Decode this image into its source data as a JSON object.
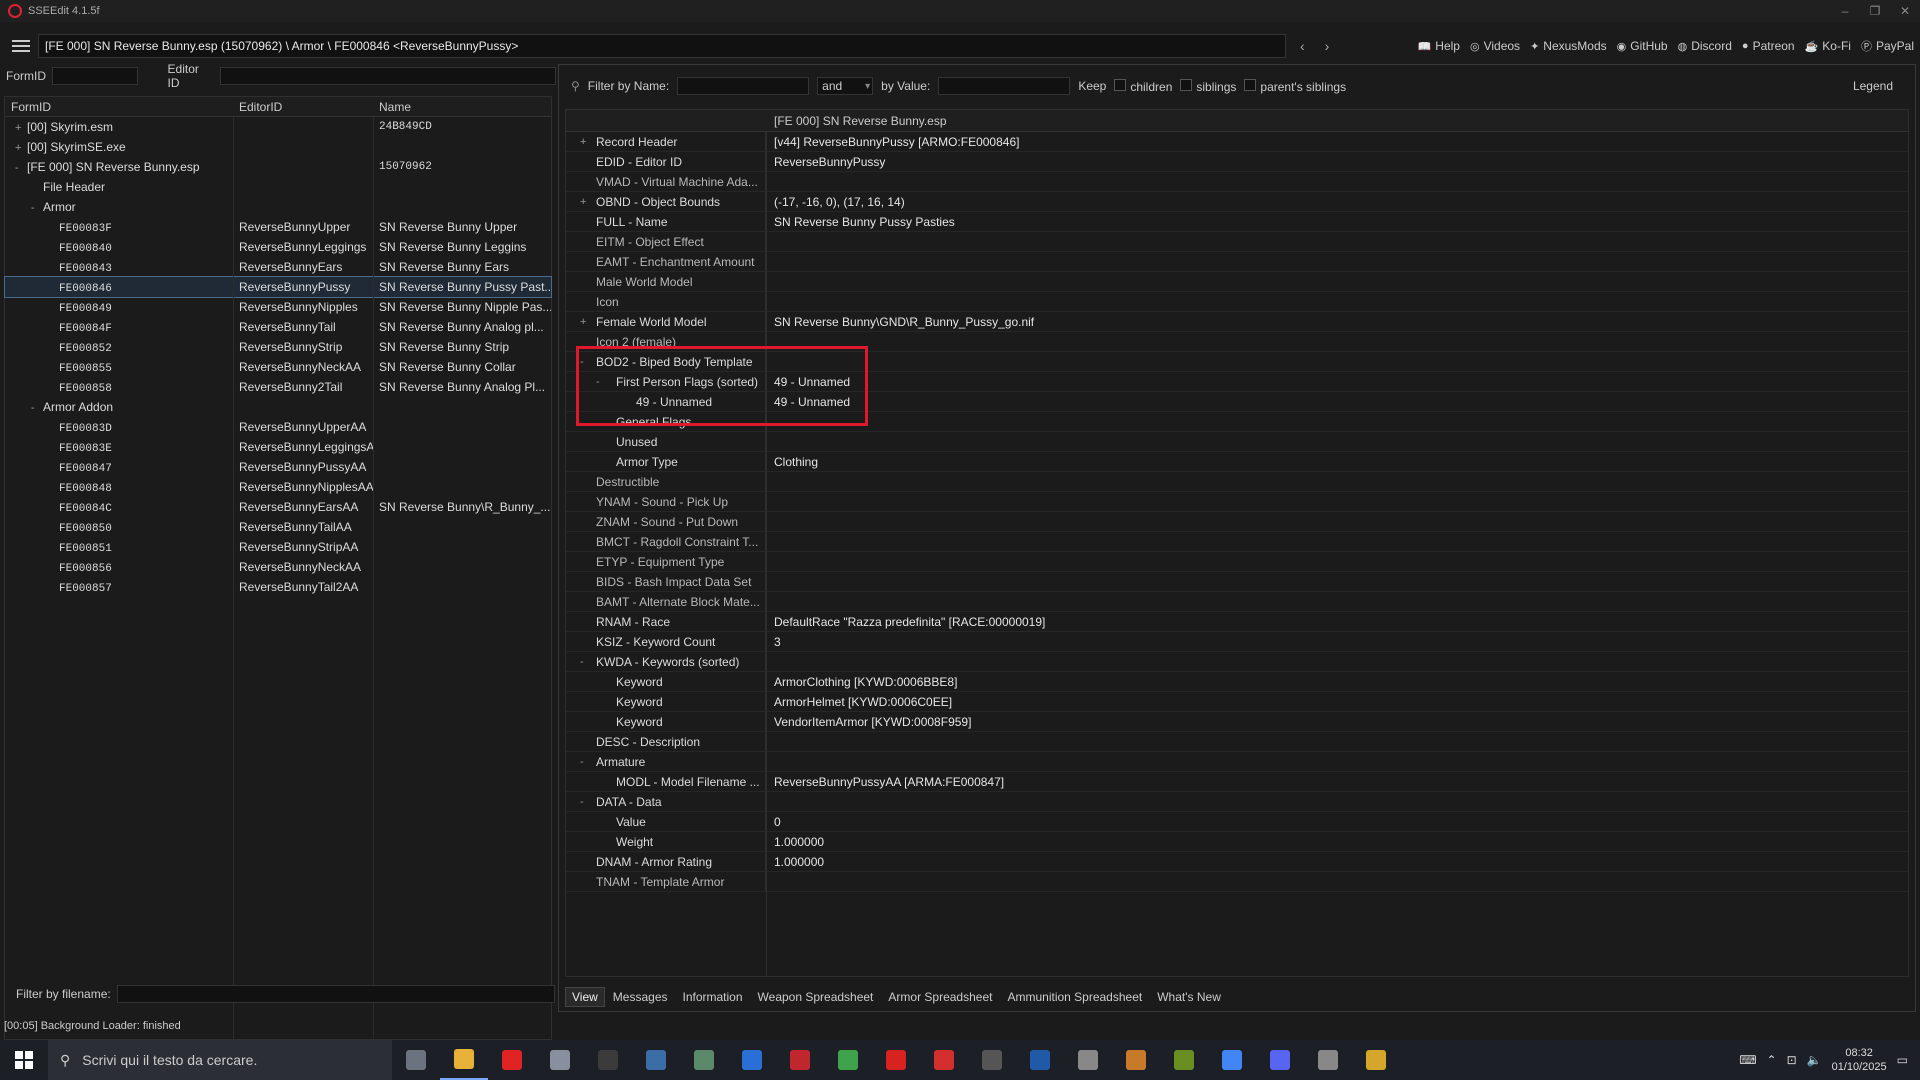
{
  "window": {
    "title": "SSEEdit 4.1.5f",
    "path": "[FE 000] SN Reverse Bunny.esp (15070962) \\ Armor \\ FE000846 <ReverseBunnyPussy>"
  },
  "links": [
    "Help",
    "Videos",
    "NexusMods",
    "GitHub",
    "Discord",
    "Patreon",
    "Ko-Fi",
    "PayPal"
  ],
  "left": {
    "formid_label": "FormID",
    "editorid_label": "Editor ID",
    "headers": [
      "FormID",
      "EditorID",
      "Name"
    ],
    "rows": [
      {
        "c1": "[00] Skyrim.esm",
        "c2": "",
        "c3": "24B849CD",
        "lvl": 0,
        "exp": "+"
      },
      {
        "c1": "[00] SkyrimSE.exe",
        "c2": "",
        "c3": "",
        "lvl": 0,
        "exp": "+"
      },
      {
        "c1": "[FE 000] SN Reverse Bunny.esp",
        "c2": "",
        "c3": "15070962",
        "lvl": 0,
        "exp": "-"
      },
      {
        "c1": "File Header",
        "c2": "",
        "c3": "",
        "lvl": 1,
        "exp": ""
      },
      {
        "c1": "Armor",
        "c2": "",
        "c3": "",
        "lvl": 1,
        "exp": "-"
      },
      {
        "c1": "FE00083F",
        "c2": "ReverseBunnyUpper",
        "c3": "SN Reverse Bunny Upper",
        "lvl": 2,
        "exp": "",
        "mono": true
      },
      {
        "c1": "FE000840",
        "c2": "ReverseBunnyLeggings",
        "c3": "SN Reverse Bunny Leggins",
        "lvl": 2,
        "exp": "",
        "mono": true
      },
      {
        "c1": "FE000843",
        "c2": "ReverseBunnyEars",
        "c3": "SN Reverse Bunny Ears",
        "lvl": 2,
        "exp": "",
        "mono": true
      },
      {
        "c1": "FE000846",
        "c2": "ReverseBunnyPussy",
        "c3": "SN Reverse Bunny Pussy Past...",
        "lvl": 2,
        "exp": "",
        "mono": true,
        "sel": true
      },
      {
        "c1": "FE000849",
        "c2": "ReverseBunnyNipples",
        "c3": "SN Reverse Bunny Nipple Pas...",
        "lvl": 2,
        "exp": "",
        "mono": true
      },
      {
        "c1": "FE00084F",
        "c2": "ReverseBunnyTail",
        "c3": "SN Reverse Bunny Analog pl...",
        "lvl": 2,
        "exp": "",
        "mono": true
      },
      {
        "c1": "FE000852",
        "c2": "ReverseBunnyStrip",
        "c3": "SN Reverse Bunny Strip",
        "lvl": 2,
        "exp": "",
        "mono": true
      },
      {
        "c1": "FE000855",
        "c2": "ReverseBunnyNeckAA",
        "c3": "SN Reverse Bunny Collar",
        "lvl": 2,
        "exp": "",
        "mono": true
      },
      {
        "c1": "FE000858",
        "c2": "ReverseBunny2Tail",
        "c3": "SN Reverse Bunny Analog Pl...",
        "lvl": 2,
        "exp": "",
        "mono": true
      },
      {
        "c1": "Armor Addon",
        "c2": "",
        "c3": "",
        "lvl": 1,
        "exp": "-"
      },
      {
        "c1": "FE00083D",
        "c2": "ReverseBunnyUpperAA",
        "c3": "",
        "lvl": 2,
        "exp": "",
        "mono": true
      },
      {
        "c1": "FE00083E",
        "c2": "ReverseBunnyLeggingsAA",
        "c3": "",
        "lvl": 2,
        "exp": "",
        "mono": true
      },
      {
        "c1": "FE000847",
        "c2": "ReverseBunnyPussyAA",
        "c3": "",
        "lvl": 2,
        "exp": "",
        "mono": true
      },
      {
        "c1": "FE000848",
        "c2": "ReverseBunnyNipplesAA",
        "c3": "",
        "lvl": 2,
        "exp": "",
        "mono": true
      },
      {
        "c1": "FE00084C",
        "c2": "ReverseBunnyEarsAA",
        "c3": "SN Reverse Bunny\\R_Bunny_...",
        "lvl": 2,
        "exp": "",
        "mono": true
      },
      {
        "c1": "FE000850",
        "c2": "ReverseBunnyTailAA",
        "c3": "",
        "lvl": 2,
        "exp": "",
        "mono": true
      },
      {
        "c1": "FE000851",
        "c2": "ReverseBunnyStripAA",
        "c3": "",
        "lvl": 2,
        "exp": "",
        "mono": true
      },
      {
        "c1": "FE000856",
        "c2": "ReverseBunnyNeckAA",
        "c3": "",
        "lvl": 2,
        "exp": "",
        "mono": true
      },
      {
        "c1": "FE000857",
        "c2": "ReverseBunnyTail2AA",
        "c3": "",
        "lvl": 2,
        "exp": "",
        "mono": true
      }
    ],
    "filter_filename_label": "Filter by filename:"
  },
  "right": {
    "filter_name_label": "Filter by Name:",
    "and": "and",
    "by_value_label": "by Value:",
    "keep": "Keep",
    "children": "children",
    "siblings": "siblings",
    "parents_siblings": "parent's siblings",
    "legend": "Legend",
    "column_header": "[FE 000] SN Reverse Bunny.esp",
    "rows": [
      {
        "l": "Record Header",
        "v": "[v44] ReverseBunnyPussy [ARMO:FE000846]",
        "lvl": 0,
        "exp": "+"
      },
      {
        "l": "EDID - Editor ID",
        "v": "ReverseBunnyPussy",
        "lvl": 0,
        "exp": ""
      },
      {
        "l": "VMAD - Virtual Machine Ada...",
        "v": "",
        "lvl": 0,
        "exp": "",
        "dim": true
      },
      {
        "l": "OBND - Object Bounds",
        "v": "(-17, -16, 0), (17, 16, 14)",
        "lvl": 0,
        "exp": "+"
      },
      {
        "l": "FULL - Name",
        "v": "SN Reverse Bunny Pussy Pasties",
        "lvl": 0,
        "exp": ""
      },
      {
        "l": "EITM - Object Effect",
        "v": "",
        "lvl": 0,
        "exp": "",
        "dim": true
      },
      {
        "l": "EAMT - Enchantment Amount",
        "v": "",
        "lvl": 0,
        "exp": "",
        "dim": true
      },
      {
        "l": "Male World Model",
        "v": "",
        "lvl": 0,
        "exp": "",
        "dim": true
      },
      {
        "l": "Icon",
        "v": "",
        "lvl": 0,
        "exp": "",
        "dim": true
      },
      {
        "l": "Female World Model",
        "v": "SN Reverse Bunny\\GND\\R_Bunny_Pussy_go.nif",
        "lvl": 0,
        "exp": "+"
      },
      {
        "l": "Icon 2 (female)",
        "v": "",
        "lvl": 0,
        "exp": "",
        "dim": true
      },
      {
        "l": "BOD2 - Biped Body Template",
        "v": "",
        "lvl": 0,
        "exp": "-"
      },
      {
        "l": "First Person Flags (sorted)",
        "v": "49 - Unnamed",
        "lvl": 1,
        "exp": "-"
      },
      {
        "l": "49 - Unnamed",
        "v": "49 - Unnamed",
        "lvl": 2,
        "exp": ""
      },
      {
        "l": "General Flags",
        "v": "",
        "lvl": 1,
        "exp": ""
      },
      {
        "l": "Unused",
        "v": "",
        "lvl": 1,
        "exp": ""
      },
      {
        "l": "Armor Type",
        "v": "Clothing",
        "lvl": 1,
        "exp": ""
      },
      {
        "l": "Destructible",
        "v": "",
        "lvl": 0,
        "exp": "",
        "dim": true
      },
      {
        "l": "YNAM - Sound - Pick Up",
        "v": "",
        "lvl": 0,
        "exp": "",
        "dim": true
      },
      {
        "l": "ZNAM - Sound - Put Down",
        "v": "",
        "lvl": 0,
        "exp": "",
        "dim": true
      },
      {
        "l": "BMCT - Ragdoll Constraint T...",
        "v": "",
        "lvl": 0,
        "exp": "",
        "dim": true
      },
      {
        "l": "ETYP - Equipment Type",
        "v": "",
        "lvl": 0,
        "exp": "",
        "dim": true
      },
      {
        "l": "BIDS - Bash Impact Data Set",
        "v": "",
        "lvl": 0,
        "exp": "",
        "dim": true
      },
      {
        "l": "BAMT - Alternate Block Mate...",
        "v": "",
        "lvl": 0,
        "exp": "",
        "dim": true
      },
      {
        "l": "RNAM - Race",
        "v": "DefaultRace \"Razza predefinita\" [RACE:00000019]",
        "lvl": 0,
        "exp": ""
      },
      {
        "l": "KSIZ - Keyword Count",
        "v": "3",
        "lvl": 0,
        "exp": ""
      },
      {
        "l": "KWDA - Keywords (sorted)",
        "v": "",
        "lvl": 0,
        "exp": "-"
      },
      {
        "l": "Keyword",
        "v": "ArmorClothing [KYWD:0006BBE8]",
        "lvl": 1,
        "exp": ""
      },
      {
        "l": "Keyword",
        "v": "ArmorHelmet [KYWD:0006C0EE]",
        "lvl": 1,
        "exp": ""
      },
      {
        "l": "Keyword",
        "v": "VendorItemArmor [KYWD:0008F959]",
        "lvl": 1,
        "exp": ""
      },
      {
        "l": "DESC - Description",
        "v": "",
        "lvl": 0,
        "exp": ""
      },
      {
        "l": "Armature",
        "v": "",
        "lvl": 0,
        "exp": "-"
      },
      {
        "l": "MODL - Model Filename ...",
        "v": "ReverseBunnyPussyAA [ARMA:FE000847]",
        "lvl": 1,
        "exp": ""
      },
      {
        "l": "DATA - Data",
        "v": "",
        "lvl": 0,
        "exp": "-"
      },
      {
        "l": "Value",
        "v": "0",
        "lvl": 1,
        "exp": ""
      },
      {
        "l": "Weight",
        "v": "1.000000",
        "lvl": 1,
        "exp": ""
      },
      {
        "l": "DNAM - Armor Rating",
        "v": "1.000000",
        "lvl": 0,
        "exp": ""
      },
      {
        "l": "TNAM - Template Armor",
        "v": "",
        "lvl": 0,
        "exp": "",
        "dim": true
      }
    ],
    "tabs": [
      "View",
      "Messages",
      "Information",
      "Weapon Spreadsheet",
      "Armor Spreadsheet",
      "Ammunition Spreadsheet",
      "What's New"
    ]
  },
  "status": "[00:05] Background Loader: finished",
  "taskbar": {
    "search_placeholder": "Scrivi qui il testo da cercare.",
    "time": "08:32",
    "date": "01/10/2025",
    "apps": [
      "#6b7280",
      "#e8b23a",
      "#e02424",
      "#8a8fa0",
      "#3b3b3b",
      "#3a6ea5",
      "#5a8a6a",
      "#2a6fd6",
      "#c0262d",
      "#3fa34d",
      "#d82222",
      "#d32f2f",
      "#555",
      "#1e5aa8",
      "#888",
      "#c77b2a",
      "#6b8e23",
      "#4285f4",
      "#5865f2",
      "#888",
      "#d4a72c"
    ],
    "accent": "#e0182c"
  }
}
